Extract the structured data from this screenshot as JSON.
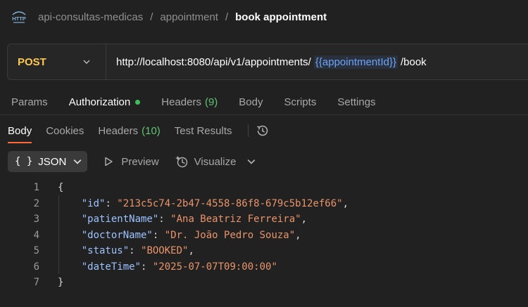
{
  "breadcrumb": {
    "items": [
      "api-consultas-medicas",
      "appointment"
    ],
    "separator": "/",
    "current": "book appointment"
  },
  "request": {
    "method": "POST",
    "url_prefix": "http://localhost:8080/api/v1/appointments/",
    "url_variable": "{{appointmentId}}",
    "url_suffix": "/book"
  },
  "request_tabs": [
    {
      "label": "Params"
    },
    {
      "label": "Authorization",
      "active": true,
      "status_dot": true
    },
    {
      "label": "Headers",
      "count": "(9)"
    },
    {
      "label": "Body"
    },
    {
      "label": "Scripts"
    },
    {
      "label": "Settings"
    }
  ],
  "response_tabs": [
    {
      "label": "Body",
      "active": true
    },
    {
      "label": "Cookies"
    },
    {
      "label": "Headers",
      "count": "(10)"
    },
    {
      "label": "Test Results"
    }
  ],
  "toolbar": {
    "format_braces": "{ }",
    "format_label": "JSON",
    "preview_label": "Preview",
    "visualize_label": "Visualize"
  },
  "response_body": {
    "line_numbers": [
      "1",
      "2",
      "3",
      "4",
      "5",
      "6",
      "7"
    ],
    "open_brace": "{",
    "close_brace": "}",
    "fields": [
      {
        "key": "\"id\"",
        "value": "\"213c5c74-2b47-4558-86f8-679c5b12ef66\"",
        "trail": ","
      },
      {
        "key": "\"patientName\"",
        "value": "\"Ana Beatriz Ferreira\"",
        "trail": ","
      },
      {
        "key": "\"doctorName\"",
        "value": "\"Dr. João Pedro Souza\"",
        "trail": ","
      },
      {
        "key": "\"status\"",
        "value": "\"BOOKED\"",
        "trail": ","
      },
      {
        "key": "\"dateTime\"",
        "value": "\"2025-07-07T09:00:00\"",
        "trail": ""
      }
    ]
  },
  "colors": {
    "method": "#ffc94d",
    "accent": "#ff6c37",
    "json_key": "#9cc2ff",
    "json_string": "#e9946a",
    "count": "#5ec46e",
    "variable": "#6aa4ff"
  },
  "icons": {
    "request_type": "http-icon",
    "history": "history-icon",
    "preview": "play-icon",
    "visualize": "visualize-icon"
  }
}
